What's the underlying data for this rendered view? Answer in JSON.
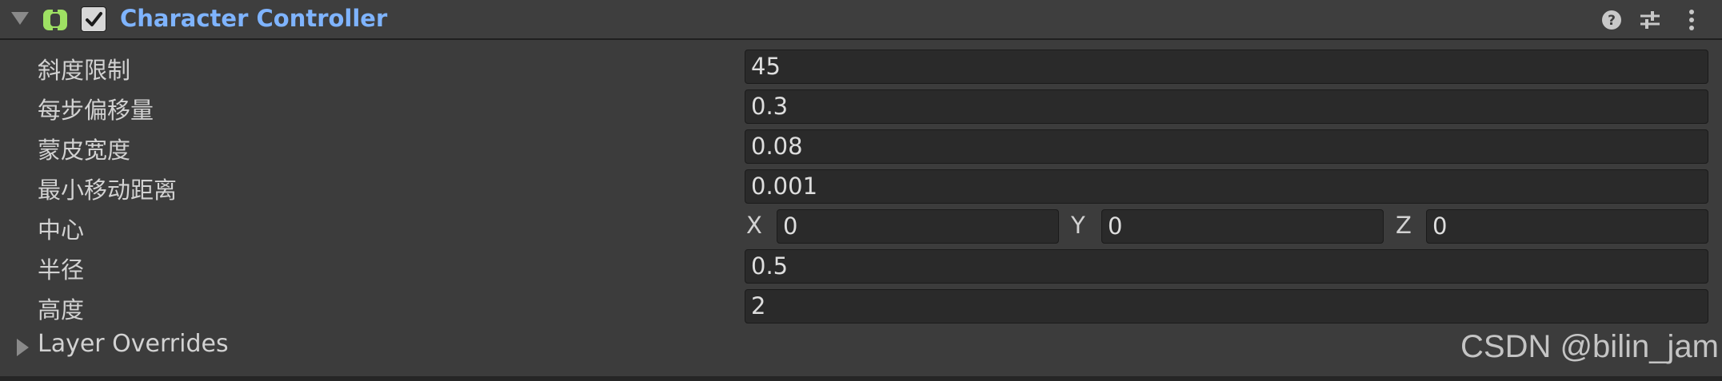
{
  "header": {
    "title": "Character Controller",
    "enabled": true,
    "icons": {
      "foldout": "chevron-down-icon",
      "component": "character-controller-icon",
      "help": "help-icon",
      "presets": "preset-sliders-icon",
      "menu": "kebab-menu-icon"
    }
  },
  "properties": {
    "slope_limit": {
      "label": "斜度限制",
      "value": "45"
    },
    "step_offset": {
      "label": "每步偏移量",
      "value": "0.3"
    },
    "skin_width": {
      "label": "蒙皮宽度",
      "value": "0.08"
    },
    "min_move_distance": {
      "label": "最小移动距离",
      "value": "0.001"
    },
    "center": {
      "label": "中心",
      "x_label": "X",
      "x": "0",
      "y_label": "Y",
      "y": "0",
      "z_label": "Z",
      "z": "0"
    },
    "radius": {
      "label": "半径",
      "value": "0.5"
    },
    "height": {
      "label": "高度",
      "value": "2"
    }
  },
  "layer_overrides": {
    "label": "Layer Overrides",
    "expanded": false
  },
  "watermark": "CSDN @bilin_jam",
  "colors": {
    "panel_bg": "#3c3c3c",
    "field_bg": "#2a2a2a",
    "title_accent": "#7fb4ff",
    "component_icon": "#9ee063"
  }
}
